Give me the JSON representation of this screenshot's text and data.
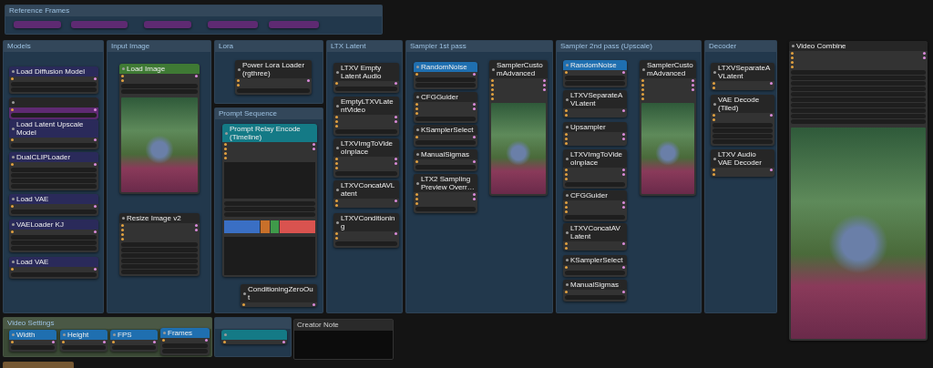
{
  "groups": [
    {
      "title": "Reference Frames",
      "color": "#22384c",
      "nodes": [
        {
          "bypassed": true,
          "collapsed": true
        },
        {
          "bypassed": true,
          "collapsed": true
        },
        {
          "bypassed": true,
          "collapsed": true
        },
        {
          "bypassed": true,
          "collapsed": true
        },
        {
          "bypassed": true,
          "collapsed": true
        }
      ]
    },
    {
      "title": "Models",
      "color": "#22384c",
      "nodes": [
        {
          "title": "Load Diffusion Model",
          "color": "#2a2a5a"
        },
        {
          "bypassed": true
        },
        {
          "title": "Load Latent Upscale Model",
          "color": "#2a2a5a"
        },
        {
          "title": "DualCLIPLoader",
          "color": "#2a2a5a"
        },
        {
          "title": "Load VAE",
          "color": "#2a2a5a"
        },
        {
          "title": "VAELoader KJ",
          "color": "#2a2a5a"
        },
        {
          "title": "Load VAE",
          "color": "#2a2a5a"
        }
      ]
    },
    {
      "title": "Input Image",
      "color": "#22384c",
      "nodes": [
        {
          "title": "Load Image",
          "color": "#3f7a34",
          "image": true
        },
        {
          "title": "Resize Image v2"
        }
      ]
    },
    {
      "title": "Lora",
      "color": "#22384c",
      "nodes": [
        {
          "title": "Power Lora Loader (rgthree)"
        }
      ]
    },
    {
      "title": "Prompt Sequence",
      "color": "#22384c",
      "nodes": [
        {
          "title": "Prompt Relay Encode (Timeline)",
          "color": "#147a86",
          "segments": [
            {
              "color": "#3a6fc4"
            },
            {
              "color": "#c8702a"
            },
            {
              "color": "#3f9a4a"
            },
            {
              "color": "#d9534f"
            }
          ]
        },
        {
          "title": "ConditioningZeroOut"
        }
      ]
    },
    {
      "title": "LTX Latent",
      "color": "#22384c",
      "nodes": [
        {
          "title": "LTXV Empty Latent Audio"
        },
        {
          "title": "EmptyLTXVLatentVideo"
        },
        {
          "title": "LTXVImgToVideoInplace"
        },
        {
          "title": "LTXVConcatAVLatent"
        },
        {
          "title": "LTXVConditioning"
        }
      ]
    },
    {
      "title": "Sampler 1st pass",
      "color": "#22384c",
      "nodes": [
        {
          "title": "RandomNoise",
          "color": "#1f6fb0"
        },
        {
          "title": "CFGGuider"
        },
        {
          "title": "KSamplerSelect"
        },
        {
          "title": "ManualSigmas"
        },
        {
          "title": "LTX2 Sampling Preview Overr…"
        },
        {
          "title": "SamplerCustomAdvanced",
          "image": true
        }
      ]
    },
    {
      "title": "Sampler 2nd pass (Upscale)",
      "color": "#22384c",
      "nodes": [
        {
          "title": "RandomNoise",
          "color": "#1f6fb0"
        },
        {
          "title": "LTXVSeparateAVLatent"
        },
        {
          "title": "Upsampler"
        },
        {
          "title": "LTXVImgToVideoInplace"
        },
        {
          "title": "CFGGuider"
        },
        {
          "title": "LTXVConcatAVLatent"
        },
        {
          "title": "KSamplerSelect"
        },
        {
          "title": "ManualSigmas"
        },
        {
          "title": "SamplerCustomAdvanced",
          "image": true
        }
      ]
    },
    {
      "title": "Decoder",
      "color": "#22384c",
      "nodes": [
        {
          "title": "LTXVSeparateAVLatent"
        },
        {
          "title": "VAE Decode (Tiled)"
        },
        {
          "title": "LTXV Audio VAE Decoder"
        }
      ]
    },
    {
      "title": "Video Settings",
      "color": "#3b4a36",
      "nodes": [
        {
          "title": "Width",
          "color": "#1f6fb0"
        },
        {
          "title": "Height",
          "color": "#1f6fb0"
        },
        {
          "title": "FPS",
          "color": "#1f6fb0"
        },
        {
          "title": "Frames",
          "color": "#1f6fb0"
        }
      ]
    },
    {
      "color": "#22384c",
      "nodes": [
        {
          "color": "#147a86"
        }
      ]
    },
    {
      "color": "#6a4a22"
    }
  ],
  "video_combine": {
    "title": "Video Combine",
    "image": true
  },
  "note": {
    "title": "Creator Note"
  }
}
